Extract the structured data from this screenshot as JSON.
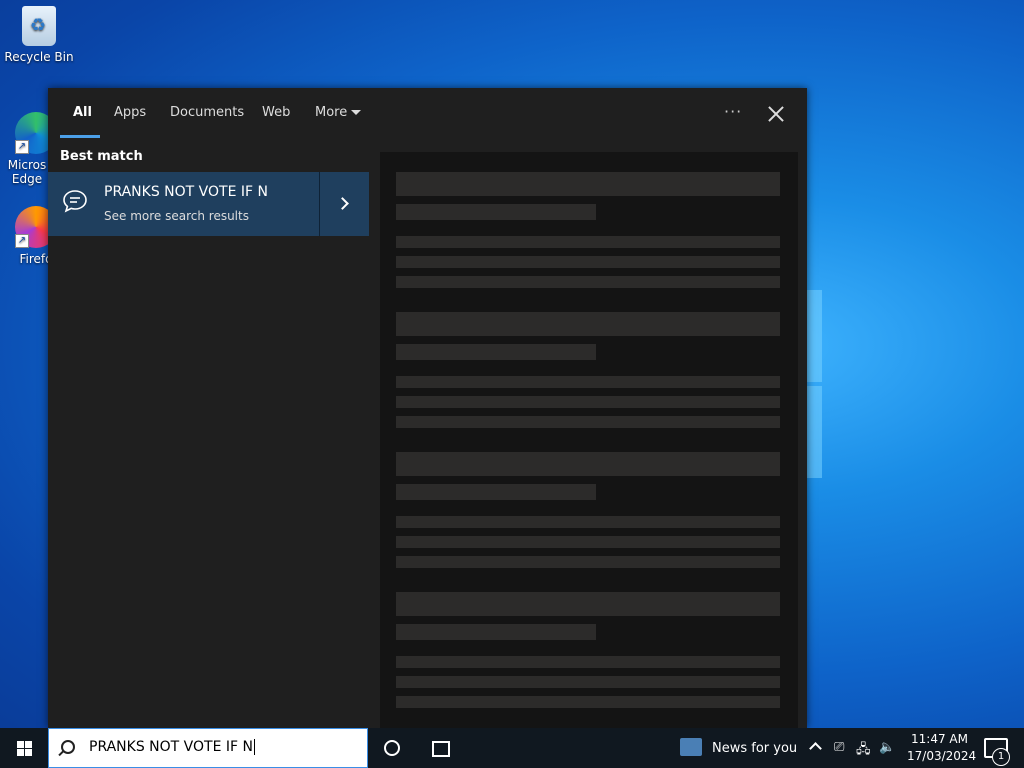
{
  "desktop": {
    "icons": [
      {
        "label": "Recycle Bin"
      },
      {
        "label": "Micros Edge"
      },
      {
        "label": "Firefo"
      }
    ]
  },
  "search_panel": {
    "tabs": [
      {
        "label": "All"
      },
      {
        "label": "Apps"
      },
      {
        "label": "Documents"
      },
      {
        "label": "Web"
      },
      {
        "label": "More"
      }
    ],
    "more_icon": "ellipsis-icon",
    "best_match_label": "Best match",
    "result": {
      "title": "PRANKS NOT VOTE IF N",
      "subtitle": "See more search results",
      "icon": "chat-bubble-icon"
    }
  },
  "taskbar": {
    "search_text": "PRANKS NOT VOTE IF N",
    "news_label": "News for you",
    "clock_time": "11:47 AM",
    "clock_date": "17/03/2024",
    "notification_count": "1"
  },
  "colors": {
    "accent": "#4ca0e8",
    "result_bg": "#1f3f5e",
    "panel_bg": "#1f1f1f",
    "taskbar_bg": "#101820"
  }
}
